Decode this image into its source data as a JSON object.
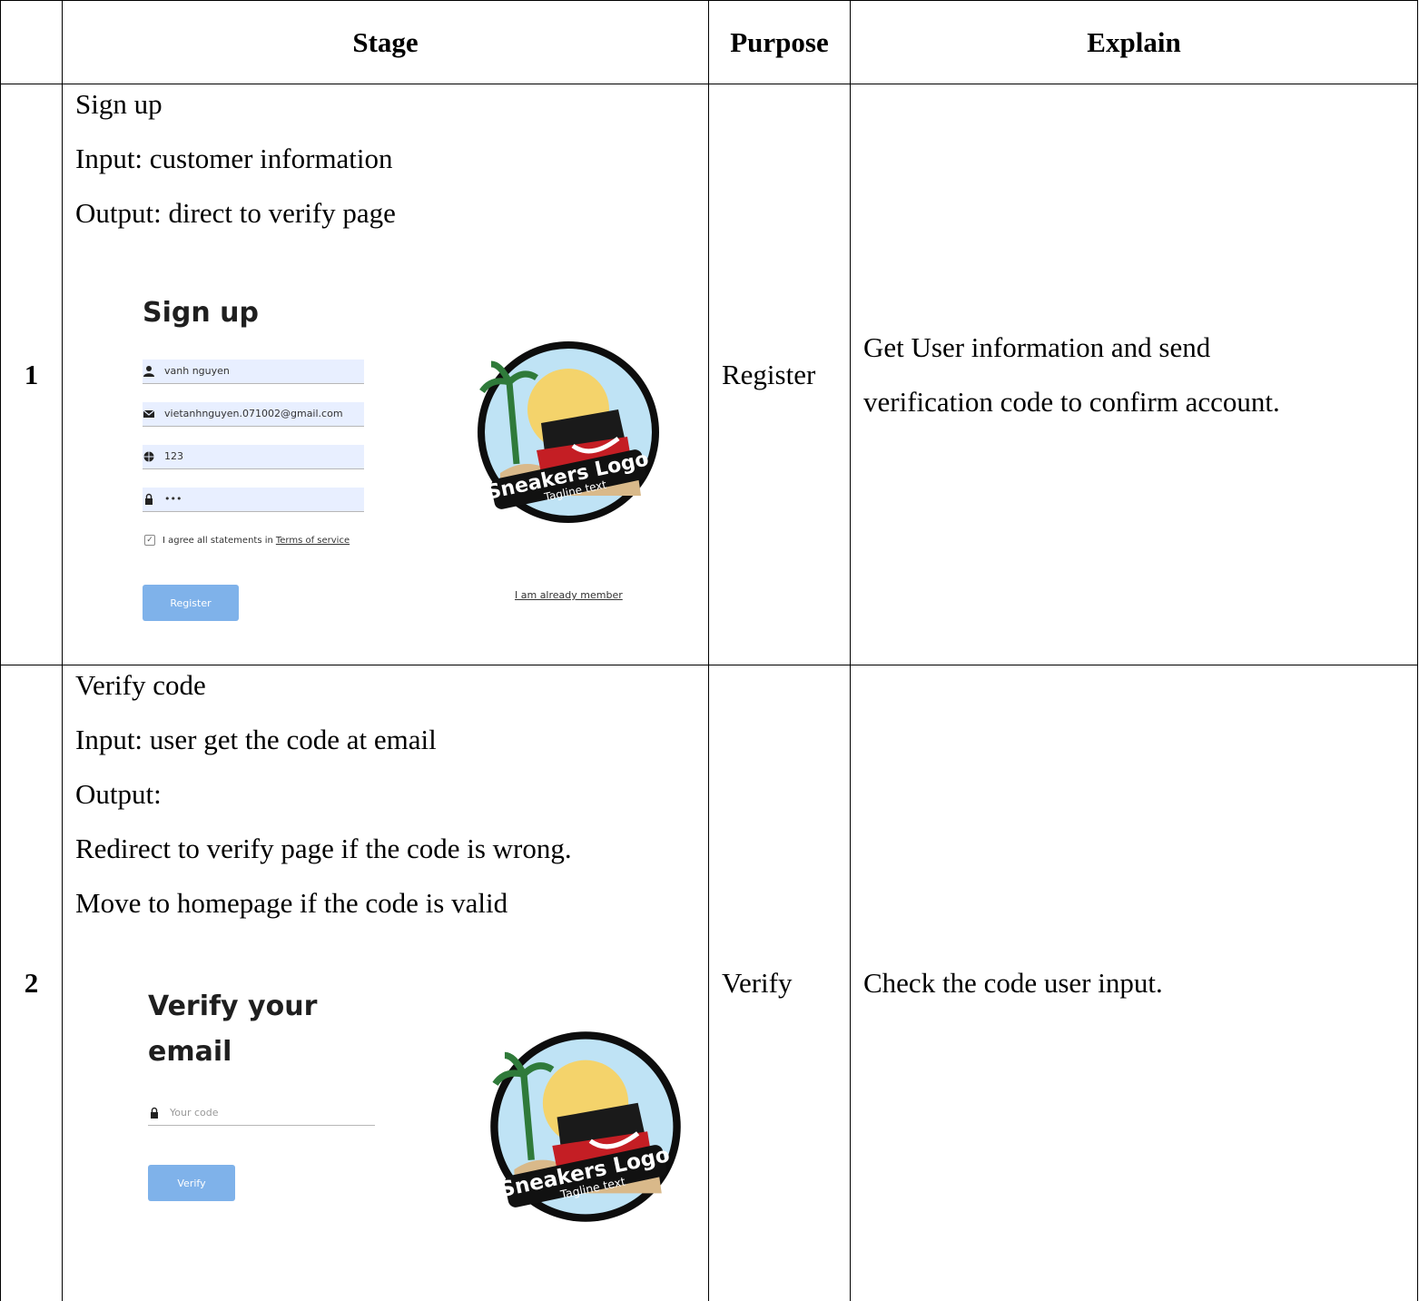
{
  "table": {
    "headers": {
      "number": "",
      "stage": "Stage",
      "purpose": "Purpose",
      "explain": "Explain"
    },
    "rows": [
      {
        "number": "1",
        "stage_lines": [
          "Sign up",
          "Input: customer information",
          "Output: direct to verify page"
        ],
        "purpose": "Register",
        "explain_lines": [
          "Get User information and send",
          "verification code to confirm account."
        ],
        "mock": {
          "title": "Sign up",
          "fields": [
            "vanh nguyen",
            "vietanhnguyen.071002@gmail.com",
            "123",
            "•••"
          ],
          "agree_text": "I agree all statements in",
          "terms_link": "Terms of service",
          "button": "Register",
          "member_link": "I am already member",
          "logo_text": "Sneakers Logo",
          "logo_tagline": "Tagline text"
        }
      },
      {
        "number": "2",
        "stage_lines": [
          "Verify code",
          "Input: user get the code at email",
          "Output:",
          "Redirect to verify page if the code is wrong.",
          "Move to homepage if the code is valid"
        ],
        "purpose": "Verify",
        "explain_lines": [
          "Check the code user input."
        ],
        "mock": {
          "title_line1": "Verify your",
          "title_line2": "email",
          "code_placeholder": "Your code",
          "button": "Verify",
          "logo_text": "Sneakers Logo",
          "logo_tagline": "Tagline text"
        }
      }
    ]
  },
  "colors": {
    "accent_button": "#7fb2ea",
    "field_bg": "#e8efff"
  },
  "icons": [
    "user-icon",
    "mail-icon",
    "globe-icon",
    "lock-icon",
    "check-icon",
    "sneakers-logo"
  ]
}
